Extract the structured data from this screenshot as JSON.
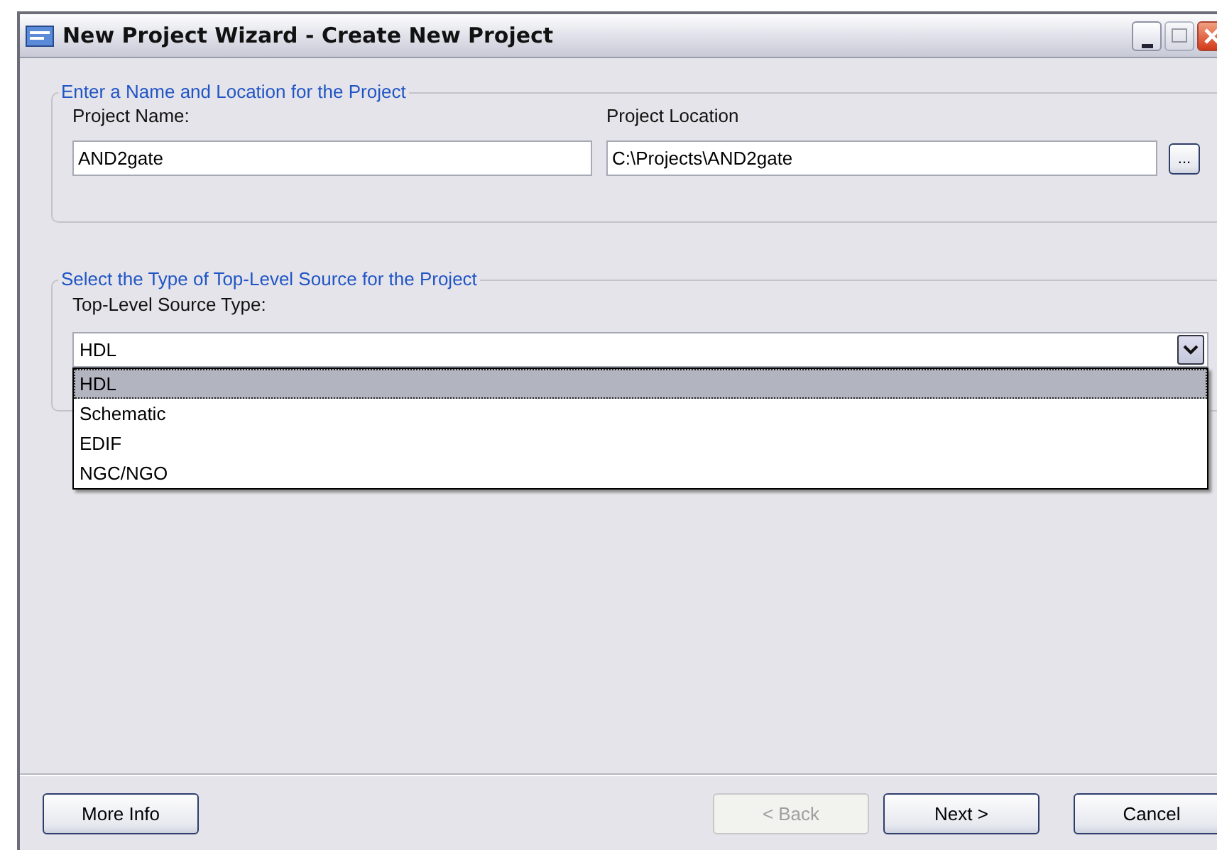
{
  "window": {
    "title": "New Project Wizard - Create New Project"
  },
  "name_location": {
    "legend": "Enter a Name and Location for the Project",
    "fields": [
      {
        "label": "Project Name:",
        "value": "AND2gate",
        "kind": "text"
      },
      {
        "label": "Project Location",
        "value": "C:\\Projects\\AND2gate",
        "kind": "browse",
        "browse_label": "..."
      }
    ]
  },
  "source": {
    "legend": "Select the Type of Top-Level Source for the Project",
    "label": "Top-Level Source Type:",
    "value": "HDL",
    "expanded": true,
    "options": [
      {
        "label": "HDL",
        "selected": true
      },
      {
        "label": "Schematic",
        "selected": false
      },
      {
        "label": "EDIF",
        "selected": false
      },
      {
        "label": "NGC/NGO",
        "selected": false
      }
    ]
  },
  "buttons": [
    {
      "label": "More Info",
      "disabled": false
    },
    {
      "label": "< Back",
      "disabled": true
    },
    {
      "label": "Next >",
      "disabled": false
    },
    {
      "label": "Cancel",
      "disabled": false
    }
  ]
}
